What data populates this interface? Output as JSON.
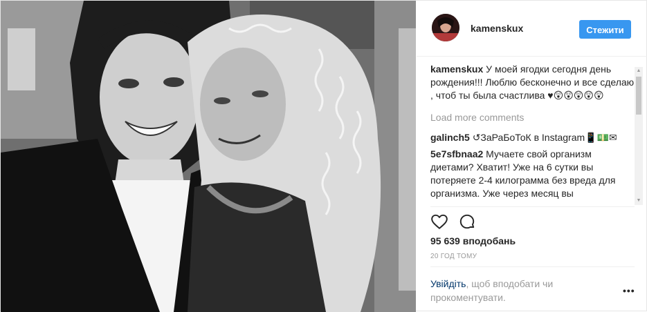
{
  "post": {
    "username": "kamenskux",
    "follow_label": "Стежити",
    "caption": {
      "user": "kamenskux",
      "text": "У моей ягодки сегодня день рождения!!! Люблю бесконечно и все сделаю , чтоб ты была счастлива ♥😲😲😲😲😲"
    },
    "load_more_label": "Load more comments",
    "comments": [
      {
        "user": "galinch5",
        "text": "↺ЗаРаБоТоК в Instagram📱💵✉"
      },
      {
        "user": "5e7sfbnaa2",
        "text": "Мучаете свой организм диетами? Хватит! Уже на 6 сутки вы потеряете 2-4 килограмма без вреда для организма. Уже через месяц вы"
      }
    ],
    "likes": "95 639 вподобань",
    "timestamp": "20 ГОД ТОМУ",
    "login_link": "Увійдіть",
    "login_rest": ", щоб вподобати чи прокоментувати.",
    "more_label": "•••"
  },
  "icons": {
    "heart": "heart-icon",
    "comment": "comment-icon",
    "more": "more-options-icon"
  },
  "colors": {
    "accent": "#3897f0",
    "link": "#003569",
    "muted": "#999999"
  }
}
